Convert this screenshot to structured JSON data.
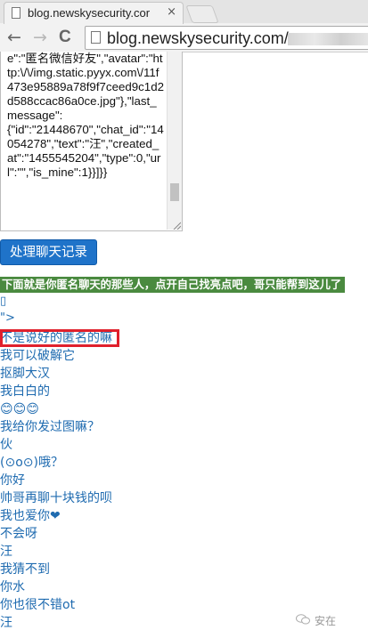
{
  "browser": {
    "tab_title": "blog.newskysecurity.cor",
    "tab_close": "×",
    "back": "←",
    "forward": "→",
    "reload": "C",
    "url": "blog.newskysecurity.com/"
  },
  "textarea": {
    "content": "e\":\"匿名微信好友\",\"avatar\":\"http:\\/\\/img.static.pyyx.com\\/11f473e95889a78f9f7ceed9c1d2d588ccac86a0ce.jpg\"},\"last_message\":\n{\"id\":\"21448670\",\"chat_id\":\"14054278\",\"text\":\"汪\",\"created_at\":\"1455545204\",\"type\":0,\"url\":\"\",\"is_mine\":1}}]}}"
  },
  "action_button": {
    "label": "处理聊天记录"
  },
  "banner": {
    "text": "下面就是你匿名聊天的那些人，点开自己找亮点吧，哥只能帮到这儿了"
  },
  "line_a": "▯",
  "line_b": "\">",
  "messages": [
    "不是说好的匿名的嘛",
    "我可以破解它",
    "抠脚大汉",
    "我白白的",
    "😊😊😊",
    "我给你发过图嘛？",
    "伙",
    "(⊙o⊙)哦？",
    "你好",
    "帅哥再聊十块钱的呗",
    "我也爱你❤",
    "不会呀",
    "汪",
    "我猜不到",
    "你水",
    "你也很不错ot",
    "汪"
  ],
  "watermark": {
    "text": "安在"
  }
}
